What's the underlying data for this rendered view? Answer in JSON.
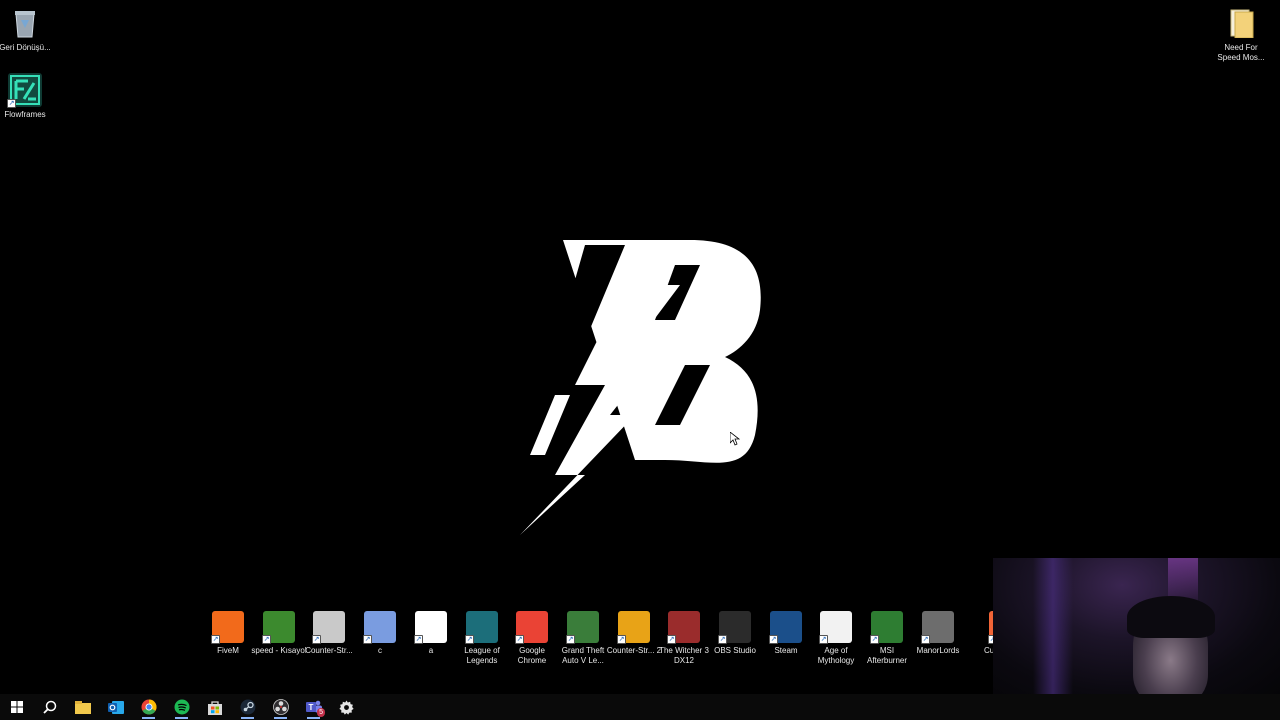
{
  "desktop": {
    "top_left_icons": [
      {
        "name": "recycle-bin-icon",
        "label": "Geri Dönüşü..."
      },
      {
        "name": "flowframes-icon",
        "label": "Flowframes"
      }
    ],
    "top_right_icons": [
      {
        "name": "folder-icon",
        "label": "Need For Speed Mos..."
      }
    ],
    "dock_icons": [
      {
        "name": "fivem-icon",
        "label": "FiveM",
        "color": "#f26a1b"
      },
      {
        "name": "speed-shortcut-icon",
        "label": "speed - Kısayol",
        "color": "#3c8a2e"
      },
      {
        "name": "counter-strike-icon",
        "label": "Counter-Str...",
        "color": "#c9c9c9"
      },
      {
        "name": "c-app-icon",
        "label": "c",
        "color": "#7a9ce0"
      },
      {
        "name": "steelseries-icon",
        "label": "a",
        "color": "#ffffff"
      },
      {
        "name": "league-of-legends-icon",
        "label": "League of Legends",
        "color": "#1c6e7a"
      },
      {
        "name": "google-chrome-icon",
        "label": "Google Chrome",
        "color": "#ea4335"
      },
      {
        "name": "gta-v-icon",
        "label": "Grand Theft Auto V Le...",
        "color": "#3a7d3a"
      },
      {
        "name": "counter-strike-2-icon",
        "label": "Counter-Str... 2",
        "color": "#e8a317"
      },
      {
        "name": "witcher-3-icon",
        "label": "The Witcher 3 DX12",
        "color": "#9a2c2c"
      },
      {
        "name": "obs-studio-icon",
        "label": "OBS Studio",
        "color": "#2b2b2b"
      },
      {
        "name": "steam-icon",
        "label": "Steam",
        "color": "#1b4f8a"
      },
      {
        "name": "age-of-mythology-icon",
        "label": "Age of Mythology",
        "color": "#f2f2f2"
      },
      {
        "name": "msi-afterburner-icon",
        "label": "MSI Afterburner",
        "color": "#2e7d32"
      },
      {
        "name": "manor-lords-icon",
        "label": "ManorLords",
        "color": "#6d6d6d"
      },
      {
        "name": "curseforge-icon",
        "label": "CurseFo...",
        "color": "#f16436"
      }
    ]
  },
  "wallpaper": {
    "logo": "lightning-b-logo",
    "color": "#ffffff",
    "background": "#000000"
  },
  "taskbar": {
    "items": [
      {
        "name": "start-button-icon"
      },
      {
        "name": "search-icon"
      },
      {
        "name": "file-explorer-icon"
      },
      {
        "name": "outlook-icon"
      },
      {
        "name": "chrome-taskbar-icon"
      },
      {
        "name": "spotify-icon"
      },
      {
        "name": "microsoft-store-icon"
      },
      {
        "name": "steam-taskbar-icon"
      },
      {
        "name": "obs-taskbar-icon"
      },
      {
        "name": "teams-icon",
        "badge": "5"
      },
      {
        "name": "settings-gear-icon"
      }
    ]
  }
}
